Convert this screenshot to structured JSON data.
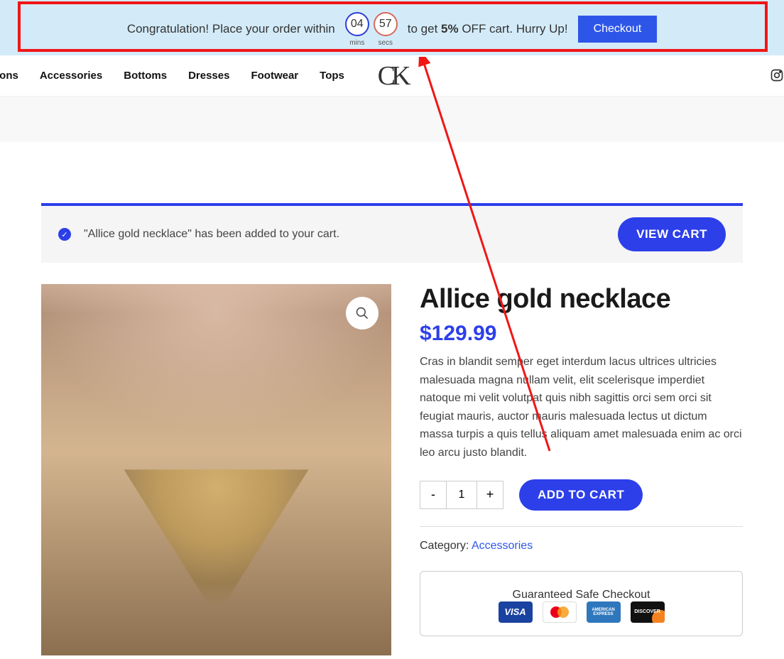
{
  "promo": {
    "left_text": "Congratulation! Place your order within",
    "timer": {
      "mins": "04",
      "secs": "57",
      "mins_label": "mins",
      "secs_label": "secs"
    },
    "right_text_pre": "to get ",
    "right_text_bold": "5%",
    "right_text_post": " OFF cart. Hurry Up!",
    "checkout_label": "Checkout"
  },
  "nav": [
    "tions",
    "Accessories",
    "Bottoms",
    "Dresses",
    "Footwear",
    "Tops"
  ],
  "logo": "CK",
  "notice": {
    "text": "\"Allice gold necklace\" has been added to your cart.",
    "view_cart": "VIEW CART"
  },
  "product": {
    "title": "Allice gold necklace",
    "price": "$129.99",
    "description": "Cras in blandit semper eget interdum lacus ultrices ultricies malesuada magna nullam velit, elit scelerisque imperdiet natoque mi velit volutpat quis nibh sagittis orci sem orci sit feugiat mauris, auctor mauris malesuada lectus ut dictum massa turpis a quis tellus aliquam amet malesuada enim ac orci leo arcu justo blandit.",
    "qty_minus": "-",
    "qty_plus": "+",
    "qty_value": "1",
    "add_to_cart": "ADD TO CART",
    "category_label": "Category: ",
    "category_value": "Accessories",
    "safe_title": "Guaranteed Safe Checkout",
    "cards": {
      "visa": "VISA",
      "mc": "mastercard",
      "amex": "AMERICAN EXPRESS",
      "disc": "DISCOVER"
    }
  }
}
